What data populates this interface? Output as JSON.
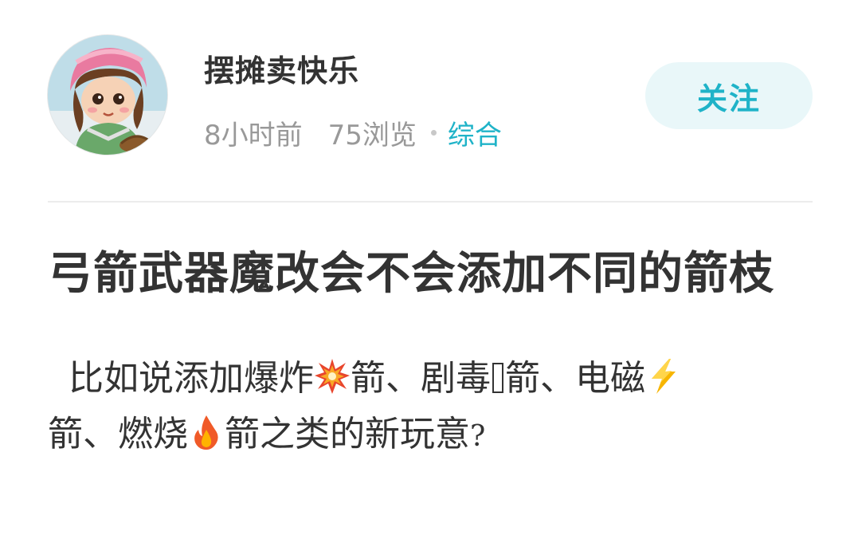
{
  "author": {
    "name": "摆摊卖快乐",
    "avatar_icon": "avatar-girl-pink-hood"
  },
  "meta": {
    "time": "8小时前",
    "views": "75浏览",
    "category": "综合"
  },
  "follow_button": {
    "label": "关注"
  },
  "post": {
    "title": "弓箭武器魔改会不会添加不同的箭枝",
    "body": {
      "seg1": "比如说添加爆炸",
      "seg2": "箭、剧毒",
      "seg3": "箭、电磁",
      "seg4": "箭、燃烧",
      "seg5": "箭之类的新玩意",
      "question_mark": "?"
    },
    "icons": {
      "explosion": "explosion-icon",
      "poison": "missing-glyph-icon",
      "lightning": "lightning-icon",
      "fire": "fire-icon"
    }
  },
  "colors": {
    "accent": "#1fb3c8",
    "follow_bg": "#e9f7f9",
    "meta_text": "#999999",
    "title_text": "#333333"
  }
}
